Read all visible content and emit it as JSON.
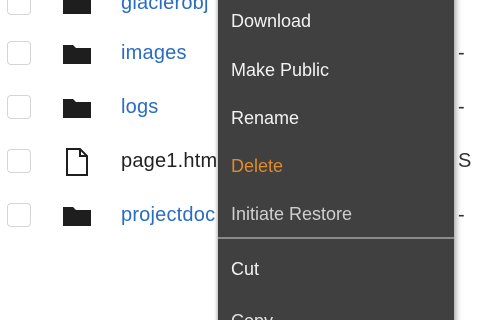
{
  "file_list": {
    "rows": [
      {
        "type": "folder",
        "name": "glacierobj",
        "right": ""
      },
      {
        "type": "folder",
        "name": "images",
        "right": "-"
      },
      {
        "type": "folder",
        "name": "logs",
        "right": "-"
      },
      {
        "type": "file",
        "name": "page1.htm",
        "right": "S"
      },
      {
        "type": "folder",
        "name": "projectdoc",
        "right": "-"
      }
    ]
  },
  "context_menu": {
    "items": {
      "download": "Download",
      "make_public": "Make Public",
      "rename": "Rename",
      "delete": "Delete",
      "initiate_restore": "Initiate Restore",
      "cut": "Cut",
      "copy": "Copy"
    },
    "colors": {
      "background": "#404040",
      "text": "#f2f2f2",
      "danger": "#e08a2e"
    }
  },
  "colors": {
    "folder_link": "#2a6cc4"
  }
}
